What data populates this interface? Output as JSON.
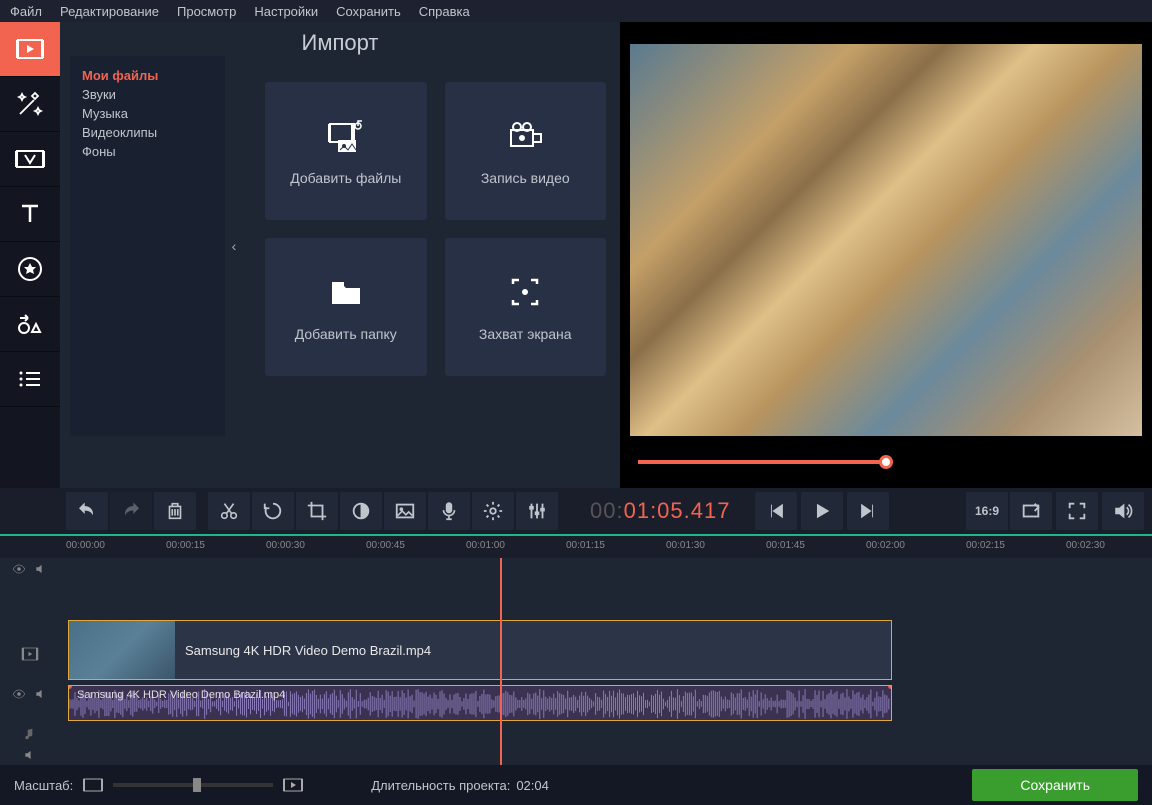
{
  "menu": [
    "Файл",
    "Редактирование",
    "Просмотр",
    "Настройки",
    "Сохранить",
    "Справка"
  ],
  "panel": {
    "title": "Импорт",
    "categories": [
      "Мои файлы",
      "Звуки",
      "Музыка",
      "Видеоклипы",
      "Фоны"
    ],
    "active_category": 0,
    "buttons": [
      {
        "label": "Добавить файлы",
        "icon": "add-files"
      },
      {
        "label": "Запись видео",
        "icon": "record-video"
      },
      {
        "label": "Добавить папку",
        "icon": "add-folder"
      },
      {
        "label": "Захват экрана",
        "icon": "screen-capture"
      }
    ]
  },
  "timecode": {
    "gray": "00:",
    "main": "01:05.417"
  },
  "aspect": "16:9",
  "ruler": [
    "00:00:00",
    "00:00:15",
    "00:00:30",
    "00:00:45",
    "00:01:00",
    "00:01:15",
    "00:01:30",
    "00:01:45",
    "00:02:00",
    "00:02:15",
    "00:02:30"
  ],
  "clip": {
    "name": "Samsung 4K HDR Video  Demo  Brazil.mp4"
  },
  "footer": {
    "zoom_label": "Масштаб:",
    "duration_label": "Длительность проекта:",
    "duration": "02:04",
    "save": "Сохранить"
  },
  "playhead_percent": 40.2,
  "preview_progress_percent": 50
}
